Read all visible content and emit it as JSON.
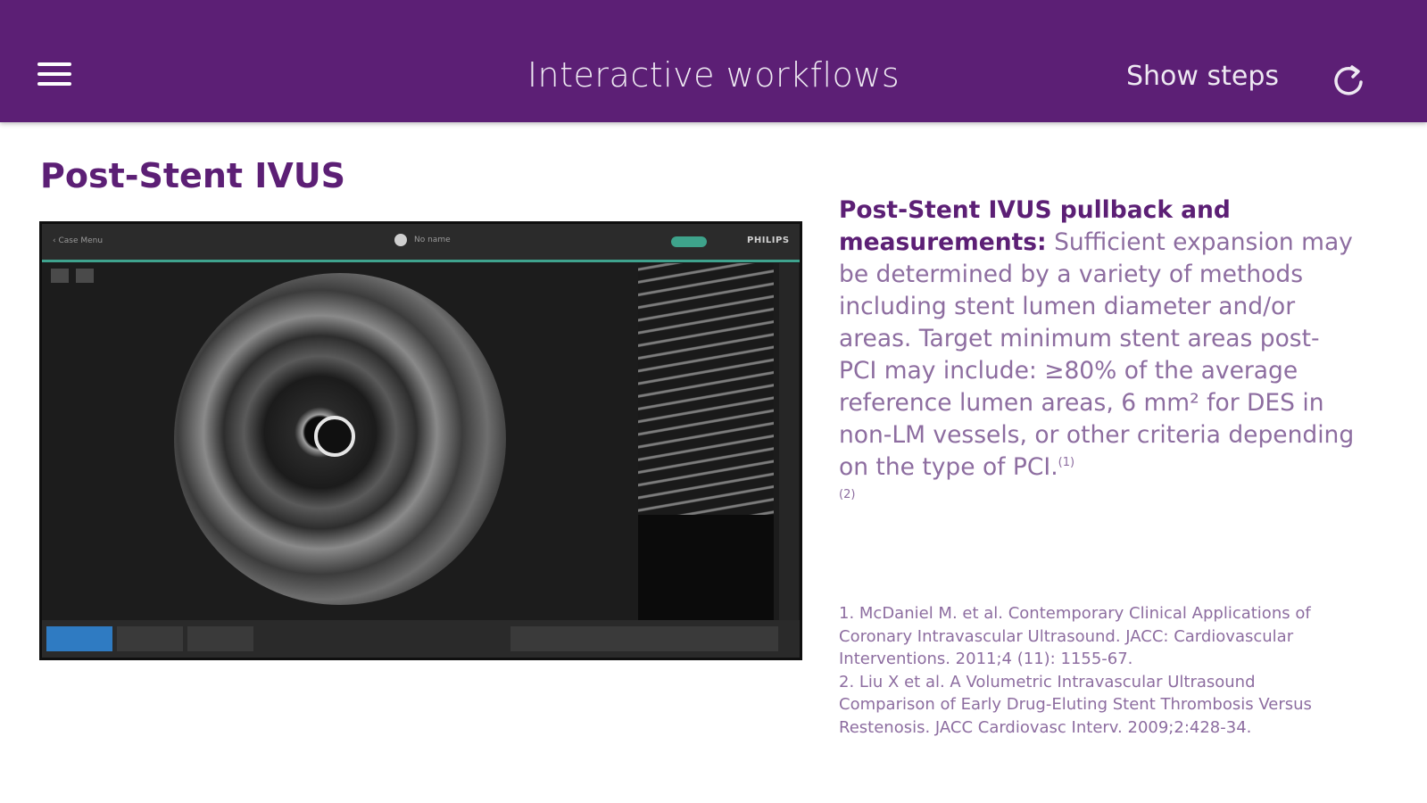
{
  "header": {
    "title": "Interactive workflows",
    "show_steps_label": "Show steps",
    "accent_color": "#5c1f75"
  },
  "page": {
    "title": "Post-Stent IVUS"
  },
  "description": {
    "heading": "Post-Stent IVUS pullback and measurements:",
    "body": " Sufficient expansion may be determined by a variety of methods including stent lumen diameter and/or areas. Target minimum stent areas post-PCI may include: ≥80% of the average reference lumen areas, 6 mm² for DES in non-LM vessels, or other criteria depending on the type of PCI.",
    "sup1": "(1)",
    "sup2": "(2)"
  },
  "references": [
    "1. McDaniel M. et al. Contemporary Clinical Applications of Coronary Intravascular Ultrasound. JACC: Cardiovascular Interventions. 2011;4 (11): 1155-67.",
    "2. Liu X et al. A Volumetric Intravascular Ultrasound Comparison of Early Drug-Eluting Stent Thrombosis Versus Restenosis. JACC Cardiovasc Interv. 2009;2:428-34."
  ],
  "screenshot": {
    "back_label": "Case Menu",
    "patient_label": "No name",
    "brand": "PHILIPS"
  },
  "icons": {
    "menu": "hamburger-icon",
    "refresh": "refresh-icon"
  }
}
